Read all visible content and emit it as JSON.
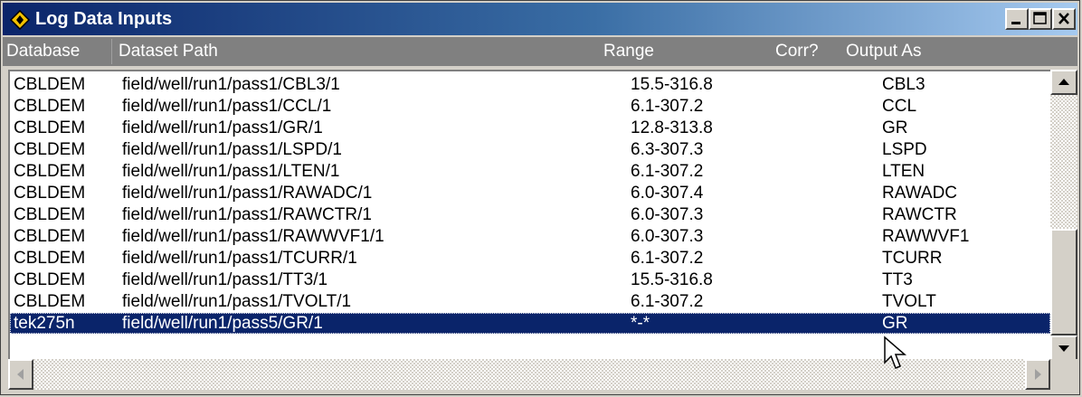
{
  "window": {
    "title": "Log Data Inputs"
  },
  "titlebar_buttons": {
    "minimize": "minimize-icon",
    "maximize": "maximize-icon",
    "close": "close-icon"
  },
  "columns": [
    "Database",
    "Dataset Path",
    "Range",
    "Corr?",
    "Output As"
  ],
  "rows": [
    {
      "database": "CBLDEM",
      "path": "field/well/run1/pass1/CBL3/1",
      "range": "15.5-316.8",
      "corr": "",
      "output": "CBL3"
    },
    {
      "database": "CBLDEM",
      "path": "field/well/run1/pass1/CCL/1",
      "range": "6.1-307.2",
      "corr": "",
      "output": "CCL"
    },
    {
      "database": "CBLDEM",
      "path": "field/well/run1/pass1/GR/1",
      "range": "12.8-313.8",
      "corr": "",
      "output": "GR"
    },
    {
      "database": "CBLDEM",
      "path": "field/well/run1/pass1/LSPD/1",
      "range": "6.3-307.3",
      "corr": "",
      "output": "LSPD"
    },
    {
      "database": "CBLDEM",
      "path": "field/well/run1/pass1/LTEN/1",
      "range": "6.1-307.2",
      "corr": "",
      "output": "LTEN"
    },
    {
      "database": "CBLDEM",
      "path": "field/well/run1/pass1/RAWADC/1",
      "range": "6.0-307.4",
      "corr": "",
      "output": "RAWADC"
    },
    {
      "database": "CBLDEM",
      "path": "field/well/run1/pass1/RAWCTR/1",
      "range": "6.0-307.3",
      "corr": "",
      "output": "RAWCTR"
    },
    {
      "database": "CBLDEM",
      "path": "field/well/run1/pass1/RAWWVF1/1",
      "range": "6.0-307.3",
      "corr": "",
      "output": "RAWWVF1"
    },
    {
      "database": "CBLDEM",
      "path": "field/well/run1/pass1/TCURR/1",
      "range": "6.1-307.2",
      "corr": "",
      "output": "TCURR"
    },
    {
      "database": "CBLDEM",
      "path": "field/well/run1/pass1/TT3/1",
      "range": "15.5-316.8",
      "corr": "",
      "output": "TT3"
    },
    {
      "database": "CBLDEM",
      "path": "field/well/run1/pass1/TVOLT/1",
      "range": "6.1-307.2",
      "corr": "",
      "output": "TVOLT"
    },
    {
      "database": "tek275n",
      "path": "field/well/run1/pass5/GR/1",
      "range": "*-*",
      "corr": "",
      "output": "GR",
      "selected": true
    }
  ],
  "colors": {
    "title_start": "#0a246a",
    "title_end": "#a6caf0",
    "header_bg": "#808080",
    "selection": "#0a246a"
  }
}
